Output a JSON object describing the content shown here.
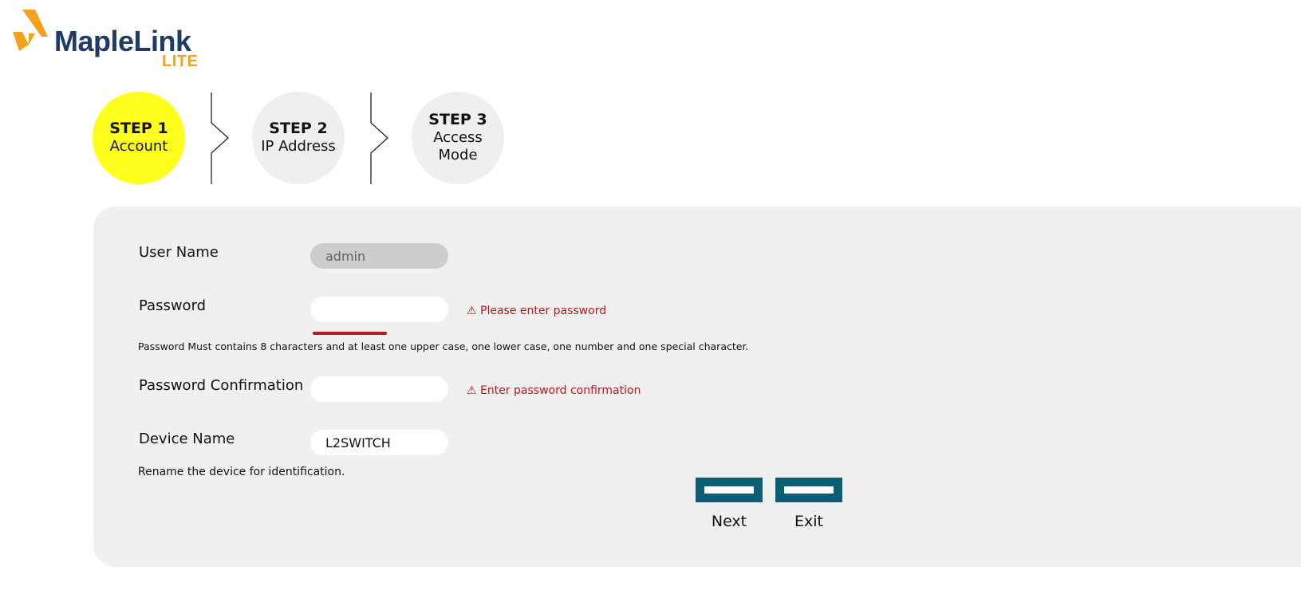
{
  "logo": {
    "brand": "MapleLink",
    "sub": "LITE",
    "icon": "maple-logo-icon",
    "colors": {
      "navy": "#1e3a66",
      "orange": "#f5a11a"
    }
  },
  "steps": [
    {
      "num": "STEP 1",
      "name": "Account",
      "active": true
    },
    {
      "num": "STEP 2",
      "name": "IP Address",
      "active": false
    },
    {
      "num": "STEP 3",
      "name": "Access Mode",
      "active": false
    }
  ],
  "form": {
    "username": {
      "label": "User Name",
      "value": "admin"
    },
    "password": {
      "label": "Password",
      "value": "",
      "error": "⚠ Please enter password",
      "hint": "Password Must contains 8 characters and at least one upper case, one lower case, one number and one special character."
    },
    "confirm": {
      "label": "Password Confirmation",
      "value": "",
      "error": "⚠ Enter password confirmation"
    },
    "device": {
      "label": "Device Name",
      "value": "L2SWITCH",
      "hint": "Rename the device for identification."
    }
  },
  "buttons": {
    "next": "Next",
    "exit": "Exit"
  },
  "colors": {
    "active_step": "#ffff1e",
    "error": "#c01818",
    "button": "#0a5f75",
    "panel": "#f0f0f0"
  }
}
